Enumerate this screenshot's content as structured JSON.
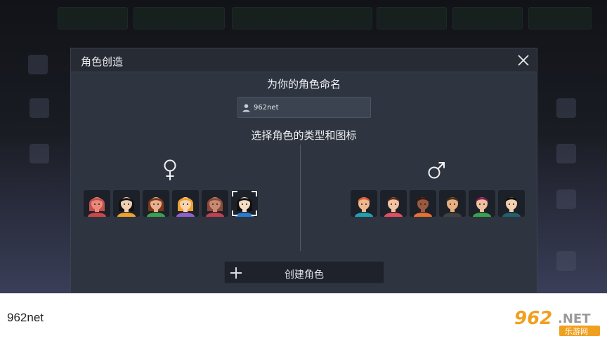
{
  "dialog": {
    "title": "角色创造",
    "name_prompt": "为你的角色命名",
    "name_value": "962net",
    "type_prompt": "选择角色的类型和图标",
    "create_label": "创建角色"
  },
  "genders": {
    "female": {
      "symbol": "♀",
      "avatars": [
        {
          "id": "f1",
          "hair": "#c25050",
          "skin": "#e88a7a",
          "shirt": "#c84848",
          "selected": false
        },
        {
          "id": "f2",
          "hair": "#121212",
          "skin": "#f2d0b4",
          "shirt": "#f0a030",
          "selected": false
        },
        {
          "id": "f3",
          "hair": "#7a3a1a",
          "skin": "#e8b090",
          "shirt": "#3aa050",
          "selected": false
        },
        {
          "id": "f4",
          "hair": "#f0a030",
          "skin": "#f8d4b0",
          "shirt": "#9060c8",
          "selected": false
        },
        {
          "id": "f5",
          "hair": "#8a4a3a",
          "skin": "#c88a70",
          "shirt": "#c04050",
          "selected": false
        },
        {
          "id": "f6",
          "hair": "#101010",
          "skin": "#f6dcc4",
          "shirt": "#2a7ad0",
          "selected": true
        }
      ]
    },
    "male": {
      "symbol": "♂",
      "avatars": [
        {
          "id": "m1",
          "hair": "#d86030",
          "skin": "#f0b890",
          "shirt": "#20a0b0",
          "selected": false
        },
        {
          "id": "m2",
          "hair": "#5a2a1a",
          "skin": "#f2c4a4",
          "shirt": "#e05060",
          "selected": false
        },
        {
          "id": "m3",
          "hair": "#3a1a10",
          "skin": "#9a5a40",
          "shirt": "#e87030",
          "selected": false
        },
        {
          "id": "m4",
          "hair": "#4a3020",
          "skin": "#e8b080",
          "shirt": "#404040",
          "selected": false
        },
        {
          "id": "m5",
          "hair": "#8a1a5a",
          "skin": "#f0c0a0",
          "shirt": "#3aa050",
          "selected": false
        },
        {
          "id": "m6",
          "hair": "#101010",
          "skin": "#f2d0b0",
          "shirt": "#20606a",
          "selected": false
        }
      ]
    }
  },
  "icons": {
    "close": "close-icon",
    "user": "user-icon",
    "plus": "plus-icon"
  },
  "caption": "962net",
  "watermark": {
    "brand": "962",
    "suffix": ".NET",
    "subtitle": "乐游网"
  },
  "colors": {
    "dialog_bg": "#2f3540",
    "header_bg": "#262b34",
    "button_bg": "#1e222b",
    "accent": "#ffffff"
  }
}
